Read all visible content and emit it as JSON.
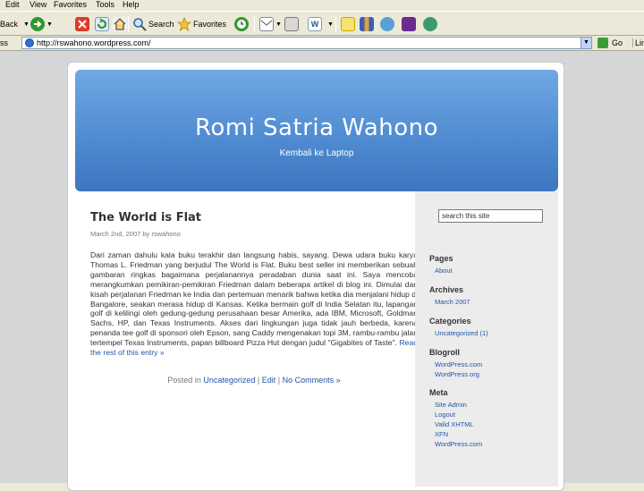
{
  "menu": [
    "Edit",
    "View",
    "Favorites",
    "Tools",
    "Help"
  ],
  "toolbar": {
    "back_label": "Back",
    "search_label": "Search",
    "favorites_label": "Favorites"
  },
  "address": {
    "label": "ss",
    "url": "http://rswahono.wordpress.com/",
    "go_label": "Go",
    "links_label": "Lin"
  },
  "blog": {
    "title": "Romi Satria Wahono",
    "description": "Kembali ke Laptop"
  },
  "post": {
    "title": "The World is Flat",
    "meta": "March 2nd, 2007 by rswahono",
    "body": "Dari zaman dahulu kala buku terakhir dan langsung habis, sayang. Dewa udara buku karya Thomas L. Friedman yang berjudul The World is Flat. Buku best seller ini memberikan sebuah gambaran ringkas bagaimana perjalanannya peradaban dunia saat ini. Saya mencoba merangkumkan pemikiran-pemikiran Friedman dalam beberapa artikel di blog ini. Dimulai dari kisah perjalanan Friedman ke India dan pertemuan menarik bahwa ketika dia menjalani hidup di Bangalore, seakan merasa hidup di Kansas. Ketika bermain golf di India Selatan itu, lapangan golf di kelilingi oleh gedung-gedung perusahaan besar Amerika, ada IBM, Microsoft, Goldman Sachs, HP, dan Texas Instruments. Akses dari lingkungan juga tidak jauh berbeda, karena penanda tee golf di sponsori oleh Epson, sang Caddy mengenakan topi 3M, rambu-rambu jalan tertempel Texas Instruments, papan billboard Pizza Hut dengan judul \"Gigabites of Taste\".",
    "read_more": "Read the rest of this entry »",
    "footer_prefix": "Posted in",
    "category": "Uncategorized",
    "edit": "Edit",
    "sep": "|",
    "comments": "No Comments »"
  },
  "sidebar": {
    "search_value": "search this site",
    "pages_heading": "Pages",
    "pages": [
      "About"
    ],
    "archives_heading": "Archives",
    "archives": [
      "March 2007"
    ],
    "categories_heading": "Categories",
    "categories": [
      "Uncategorized (1)"
    ],
    "blogroll_heading": "Blogroll",
    "blogroll": [
      "WordPress.com",
      "WordPress.org"
    ],
    "meta_heading": "Meta",
    "meta": [
      "Site Admin",
      "Logout",
      "Valid XHTML",
      "XFN",
      "WordPress.com"
    ]
  }
}
